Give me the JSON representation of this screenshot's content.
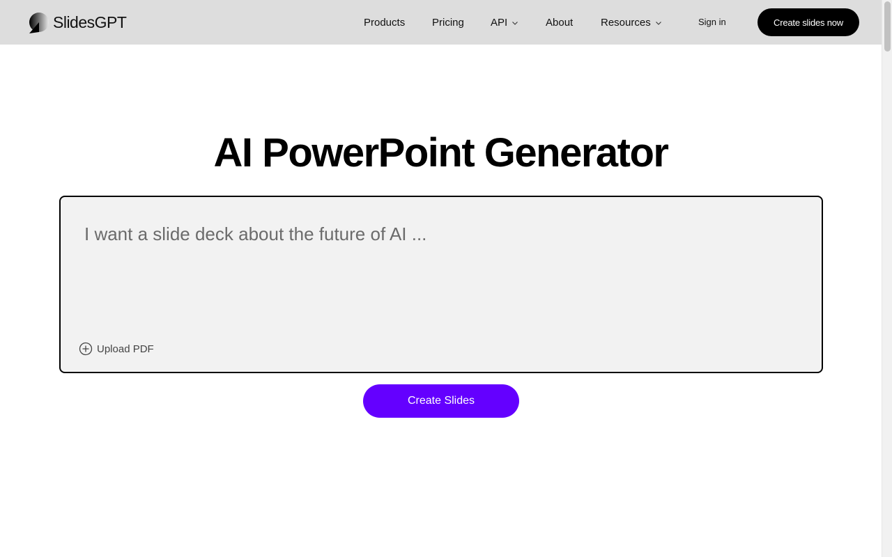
{
  "brand": {
    "name": "SlidesGPT",
    "logo_icon": "half-moon-logo-icon"
  },
  "nav": {
    "items": [
      {
        "label": "Products",
        "has_dropdown": false
      },
      {
        "label": "Pricing",
        "has_dropdown": false
      },
      {
        "label": "API",
        "has_dropdown": true
      },
      {
        "label": "About",
        "has_dropdown": false
      },
      {
        "label": "Resources",
        "has_dropdown": true
      }
    ],
    "sign_in": "Sign in",
    "cta": "Create slides now"
  },
  "hero": {
    "title": "AI PowerPoint Generator",
    "prompt_placeholder": "I want a slide deck about the future of AI ...",
    "prompt_value": "",
    "upload_label": "Upload PDF",
    "upload_icon": "plus-circle-icon",
    "submit_label": "Create Slides"
  },
  "colors": {
    "header_bg": "#dddddd",
    "accent": "#6400ff",
    "cta_bg": "#000000",
    "prompt_bg": "#f2f2f2"
  }
}
